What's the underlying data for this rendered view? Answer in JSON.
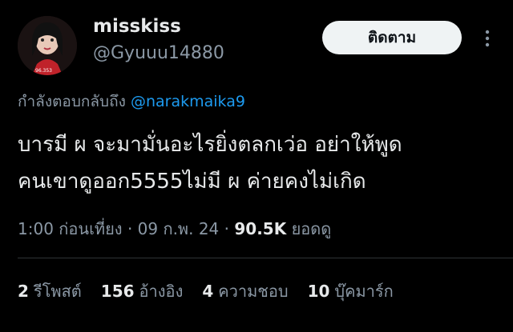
{
  "author": {
    "name": "misskiss",
    "handle": "@Gyuuu14880",
    "avatar_caption": "96.353"
  },
  "follow_label": "ติดตาม",
  "reply": {
    "prefix": "กำลังตอบกลับถึง",
    "mention": "@narakmaika9"
  },
  "tweet": {
    "lines": [
      "บารมี ผ จะมามั่นอะไรยิ่งตลกเว่อ อย่าให้พูด",
      "คนเขาดูออก5555ไม่มี ผ ค่ายคงไม่เกิด"
    ]
  },
  "meta": {
    "time": "1:00 ก่อนเที่ยง",
    "sep": "·",
    "date": "09 ก.พ. 24",
    "views_count": "90.5K",
    "views_label": "ยอดดู"
  },
  "stats": [
    {
      "count": "2",
      "label": "รีโพสต์"
    },
    {
      "count": "156",
      "label": "อ้างอิง"
    },
    {
      "count": "4",
      "label": "ความชอบ"
    },
    {
      "count": "10",
      "label": "บุ๊คมาร์ก"
    }
  ],
  "colors": {
    "background": "#000000",
    "text": "#e7e9ea",
    "muted": "#8b98a5",
    "link": "#1d9bf0",
    "button_bg": "#eff3f4"
  }
}
